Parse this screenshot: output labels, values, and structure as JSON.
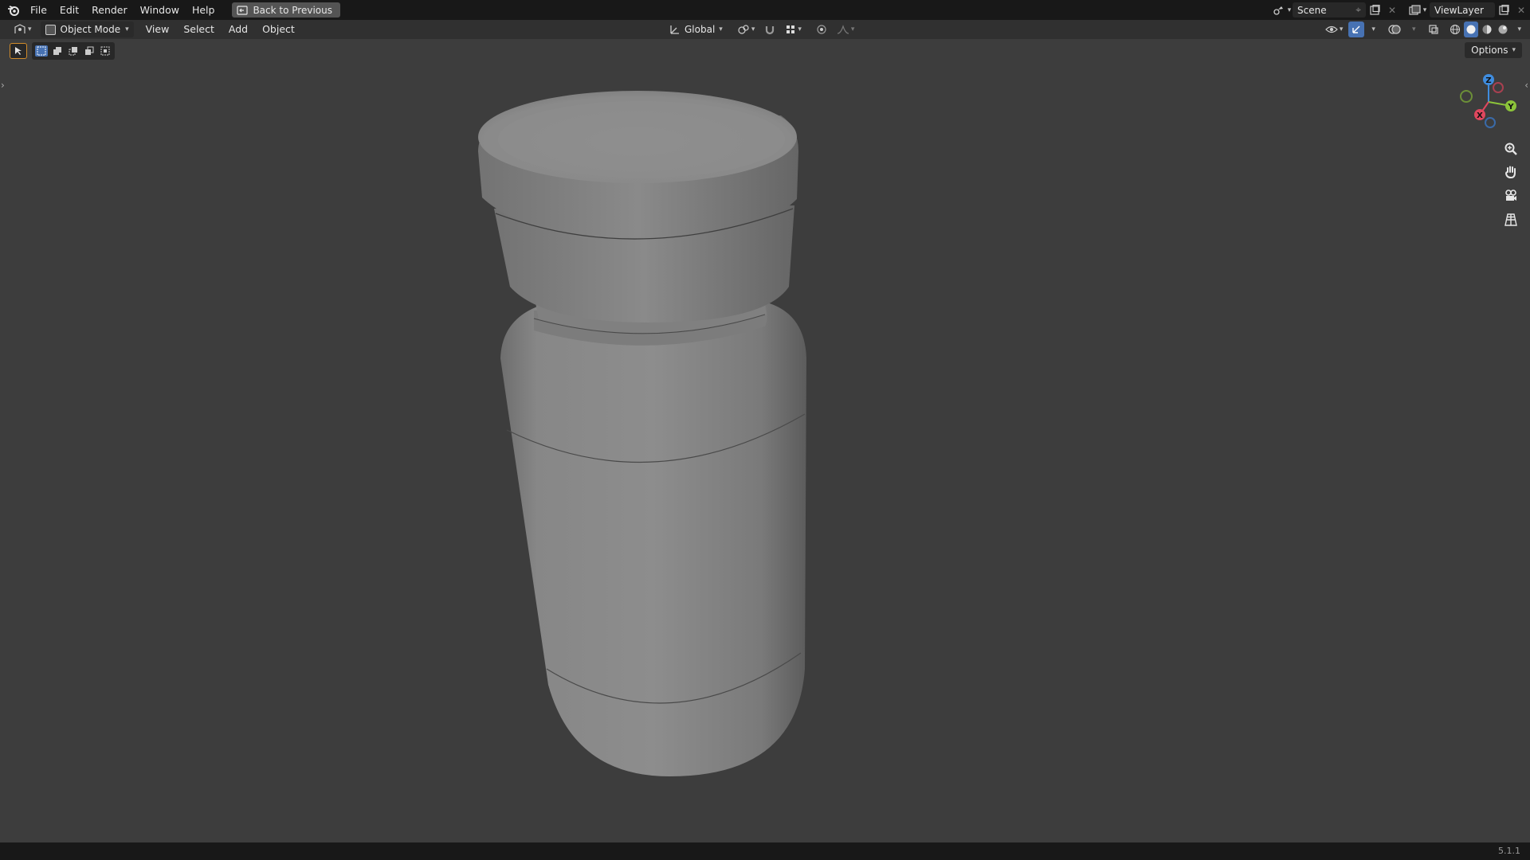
{
  "topbar": {
    "menus": [
      "File",
      "Edit",
      "Render",
      "Window",
      "Help"
    ],
    "back_button": "Back to Previous",
    "scene_name": "Scene",
    "view_layer": "ViewLayer"
  },
  "header": {
    "mode": "Object Mode",
    "menus": [
      "View",
      "Select",
      "Add",
      "Object"
    ],
    "transform_orientation": "Global",
    "options_label": "Options"
  },
  "status": {
    "version": "5.1.1"
  },
  "gizmo": {
    "labels": {
      "z": "Z",
      "y": "Y",
      "x": "X"
    },
    "colors": {
      "x": "#e0475e",
      "y": "#8cc43a",
      "z": "#3f8cde"
    }
  },
  "colors": {
    "background": "#3d3d3d",
    "accent": "#4772b3",
    "mesh": "#8a8a8a"
  }
}
